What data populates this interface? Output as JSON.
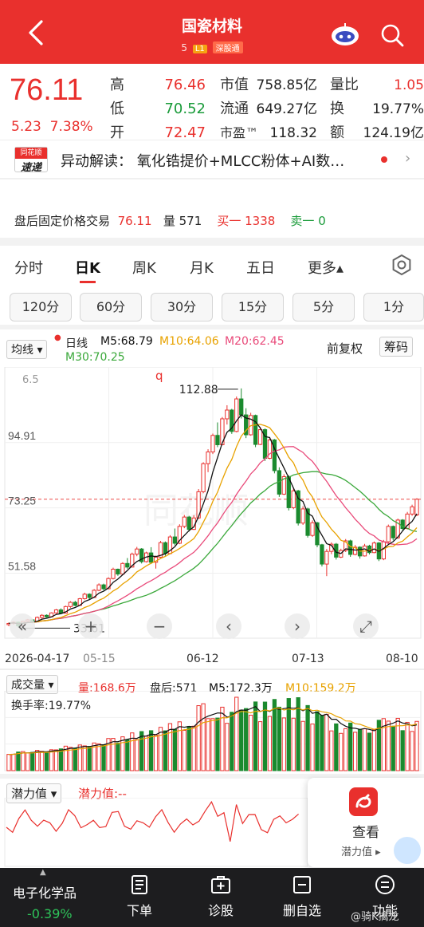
{
  "header": {
    "title": "国瓷材料",
    "code": "5",
    "level_tag": "L1",
    "exchange_tag": "深股通"
  },
  "quote": {
    "price": "76.11",
    "change": "5.23",
    "change_pct": "7.38%",
    "rows": [
      {
        "label": "高",
        "value": "76.46",
        "label2": "市值",
        "value2": "758.85亿",
        "label3": "量比",
        "value3": "1.05"
      },
      {
        "label": "低",
        "value": "70.52",
        "label2": "流通",
        "value2": "649.27亿",
        "label3": "换",
        "value3": "19.77%"
      },
      {
        "label": "开",
        "value": "72.47",
        "label2": "市盈™",
        "value2": "118.32",
        "label3": "额",
        "value3": "124.19亿"
      }
    ]
  },
  "news": {
    "logo_top": "同花顺",
    "logo_bottom": "速递",
    "text": "异动解读：  氧化锆提价+MLCC粉体+AI数…",
    "arrow": "›"
  },
  "after_hours": {
    "label": "盘后固定价格交易",
    "price": "76.11",
    "vol_label": "量",
    "vol": "571",
    "buy_label": "买一",
    "buy": "1338",
    "sell_label": "卖一",
    "sell": "0"
  },
  "tabs": [
    {
      "label": "分时"
    },
    {
      "label": "日K"
    },
    {
      "label": "周K"
    },
    {
      "label": "月K"
    },
    {
      "label": "五日"
    },
    {
      "label": "更多▴"
    }
  ],
  "minute_buttons": [
    "120分",
    "60分",
    "30分",
    "15分",
    "5分",
    "1分"
  ],
  "legend": {
    "ma_select": "均线 ▾",
    "line_type": "日线",
    "m5": "M5:68.79",
    "m10": "M10:64.06",
    "m20": "M20:62.45",
    "m30": "M30:70.25",
    "adj": "前复权",
    "chip": "筹码",
    "small_label": "6.5",
    "q_mark": "q"
  },
  "colors": {
    "up": "#e9302d",
    "down": "#1a8a2e",
    "m5": "#111111",
    "m10": "#e8a200",
    "m20": "#e94a7a",
    "m30": "#3aa83a"
  },
  "chart_data": {
    "type": "candlestick",
    "y_ticks": [
      "94.91",
      "73.25",
      "51.58"
    ],
    "high_label": "112.88",
    "low_label": "33.61",
    "current_line": "76.11",
    "x_labels": [
      "2026-04-17",
      "05-15",
      "06-12",
      "07-13",
      "08-10"
    ],
    "ylim": [
      30,
      120
    ],
    "candles": [
      [
        34.5,
        35.2,
        34.0,
        34.9
      ],
      [
        34.9,
        35.6,
        34.5,
        35.3
      ],
      [
        35.3,
        35.5,
        33.6,
        34.1
      ],
      [
        34.1,
        35.8,
        34.0,
        35.6
      ],
      [
        35.6,
        36.4,
        35.2,
        36.1
      ],
      [
        36.1,
        36.3,
        35.0,
        35.4
      ],
      [
        35.4,
        37.2,
        35.3,
        36.9
      ],
      [
        36.9,
        38.0,
        36.5,
        37.6
      ],
      [
        37.6,
        37.9,
        36.8,
        37.1
      ],
      [
        37.1,
        38.6,
        36.9,
        38.4
      ],
      [
        38.4,
        39.7,
        38.1,
        39.4
      ],
      [
        39.4,
        39.9,
        38.0,
        38.3
      ],
      [
        38.3,
        40.8,
        38.2,
        40.5
      ],
      [
        40.5,
        42.3,
        40.1,
        41.9
      ],
      [
        41.9,
        42.4,
        40.6,
        40.9
      ],
      [
        40.9,
        43.4,
        40.8,
        43.1
      ],
      [
        43.1,
        45.1,
        42.8,
        44.6
      ],
      [
        44.6,
        44.9,
        42.9,
        43.5
      ],
      [
        43.5,
        46.3,
        43.4,
        45.9
      ],
      [
        45.9,
        48.2,
        45.6,
        47.7
      ],
      [
        47.7,
        48.1,
        45.9,
        46.4
      ],
      [
        46.4,
        50.2,
        46.3,
        49.8
      ],
      [
        49.8,
        53.4,
        49.5,
        52.9
      ],
      [
        52.9,
        53.1,
        50.7,
        51.3
      ],
      [
        51.3,
        55.2,
        51.2,
        54.8
      ],
      [
        54.8,
        56.6,
        53.0,
        53.6
      ],
      [
        53.6,
        58.4,
        53.5,
        57.9
      ],
      [
        57.9,
        60.3,
        57.2,
        59.6
      ],
      [
        59.6,
        59.9,
        54.8,
        55.4
      ],
      [
        55.4,
        58.7,
        55.1,
        58.3
      ],
      [
        58.3,
        60.2,
        54.6,
        55.2
      ],
      [
        55.2,
        57.4,
        53.1,
        56.9
      ],
      [
        56.9,
        62.3,
        56.6,
        61.7
      ],
      [
        61.7,
        62.1,
        57.4,
        58.1
      ],
      [
        58.1,
        64.2,
        57.8,
        63.6
      ],
      [
        63.6,
        66.4,
        60.8,
        61.5
      ],
      [
        61.5,
        67.8,
        61.2,
        67.1
      ],
      [
        67.1,
        70.9,
        66.5,
        70.2
      ],
      [
        70.2,
        70.6,
        65.4,
        66.1
      ],
      [
        66.1,
        70.8,
        65.9,
        69.9
      ],
      [
        69.9,
        79.5,
        69.6,
        78.6
      ],
      [
        78.6,
        88.4,
        78.1,
        87.9
      ],
      [
        87.9,
        92.7,
        85.1,
        91.8
      ],
      [
        91.8,
        97.9,
        91.1,
        97.3
      ],
      [
        97.3,
        101.6,
        93.4,
        94.2
      ],
      [
        94.2,
        103.4,
        94.0,
        102.8
      ],
      [
        102.8,
        107.3,
        100.9,
        105.7
      ],
      [
        105.7,
        106.1,
        97.8,
        98.6
      ],
      [
        98.6,
        110.2,
        98.3,
        109.4
      ],
      [
        109.4,
        112.88,
        102.9,
        104.1
      ],
      [
        104.1,
        106.3,
        96.4,
        97.5
      ],
      [
        97.5,
        104.8,
        97.2,
        103.9
      ],
      [
        103.9,
        104.2,
        93.4,
        94.3
      ],
      [
        94.3,
        100.1,
        94.1,
        99.2
      ],
      [
        99.2,
        99.6,
        88.8,
        89.7
      ],
      [
        89.7,
        96.7,
        89.4,
        95.8
      ],
      [
        95.8,
        96.1,
        84.7,
        85.6
      ],
      [
        85.6,
        86.7,
        76.9,
        77.8
      ],
      [
        77.8,
        84.4,
        77.5,
        83.6
      ],
      [
        83.6,
        84.1,
        72.4,
        73.3
      ],
      [
        73.3,
        79.7,
        72.8,
        78.9
      ],
      [
        78.9,
        79.2,
        67.4,
        68.2
      ],
      [
        68.2,
        73.8,
        67.6,
        72.9
      ],
      [
        72.9,
        73.3,
        63.4,
        64.1
      ],
      [
        64.1,
        69.1,
        63.6,
        68.3
      ],
      [
        68.3,
        68.6,
        60.2,
        61.0
      ],
      [
        61.0,
        61.3,
        53.8,
        54.6
      ],
      [
        54.6,
        59.6,
        50.6,
        58.8
      ],
      [
        58.8,
        61.8,
        57.9,
        61.2
      ],
      [
        61.2,
        61.6,
        56.1,
        56.9
      ],
      [
        56.9,
        59.7,
        56.6,
        59.1
      ],
      [
        59.1,
        62.9,
        58.6,
        62.3
      ],
      [
        62.3,
        62.7,
        57.0,
        57.8
      ],
      [
        57.8,
        60.9,
        57.5,
        60.2
      ],
      [
        60.2,
        60.5,
        56.4,
        57.3
      ],
      [
        57.3,
        61.3,
        57.1,
        60.6
      ],
      [
        60.6,
        61.0,
        57.8,
        58.4
      ],
      [
        58.4,
        62.1,
        58.2,
        61.6
      ],
      [
        61.6,
        61.9,
        55.6,
        56.3
      ],
      [
        56.3,
        62.6,
        55.9,
        62.0
      ],
      [
        62.0,
        67.7,
        61.6,
        67.1
      ],
      [
        67.1,
        67.4,
        62.5,
        63.3
      ],
      [
        63.3,
        69.7,
        63.0,
        69.2
      ],
      [
        69.2,
        69.5,
        65.7,
        66.4
      ],
      [
        66.4,
        71.9,
        66.1,
        71.2
      ],
      [
        71.2,
        74.3,
        70.6,
        73.6
      ],
      [
        70.9,
        76.46,
        70.52,
        76.11
      ]
    ],
    "volume": {
      "title": "成交量",
      "vol": "量:168.6万",
      "after": "盘后:571",
      "m5": "M5:172.3万",
      "m10": "M10:159.2万",
      "turnover": "换手率:19.77%"
    }
  },
  "potential": {
    "label": "潜力值 ▾",
    "value": "潜力值:--",
    "popup_view": "查看",
    "popup_sub": "潜力值 ▸"
  },
  "bottom_nav": {
    "sector": "电子化学品",
    "sector_change": "-0.39%",
    "items": [
      {
        "label": "下单"
      },
      {
        "label": "诊股"
      },
      {
        "label": "删自选"
      },
      {
        "label": "功能"
      }
    ],
    "watermark": "@骑K擒龙"
  }
}
